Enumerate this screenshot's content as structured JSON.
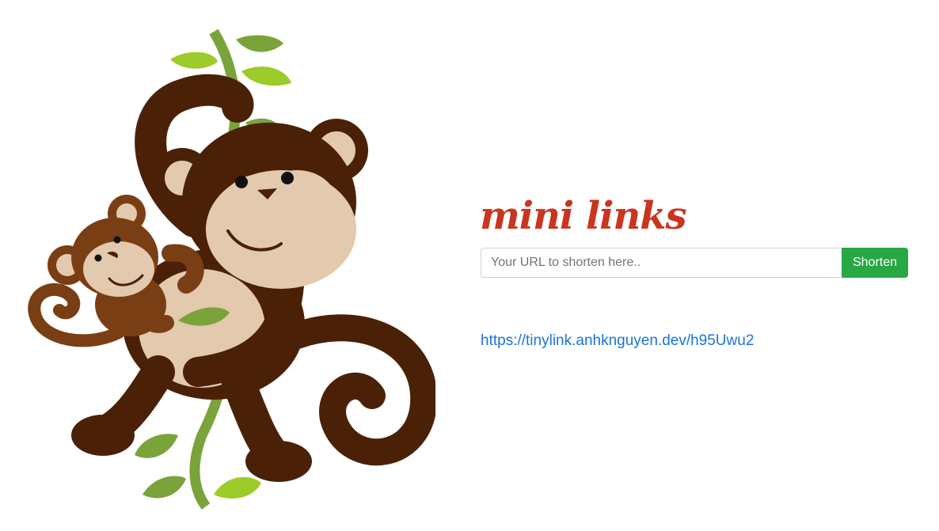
{
  "app": {
    "brand": "mini links"
  },
  "form": {
    "url_placeholder": "Your URL to shorten here..",
    "url_value": "",
    "submit_label": "Shorten"
  },
  "result": {
    "short_url": "https://tinylink.anhknguyen.dev/h95Uwu2"
  },
  "illustration": {
    "subject": "monkey-on-vine-icon"
  },
  "colors": {
    "brand": "#c9351e",
    "button": "#28a745",
    "link": "#1a73d9",
    "monkey_dark": "#4a2107",
    "monkey_light": "#e3c9ad",
    "baby_monkey": "#7a3e14",
    "vine": "#7aa33a",
    "leaf": "#9ccb2a"
  }
}
